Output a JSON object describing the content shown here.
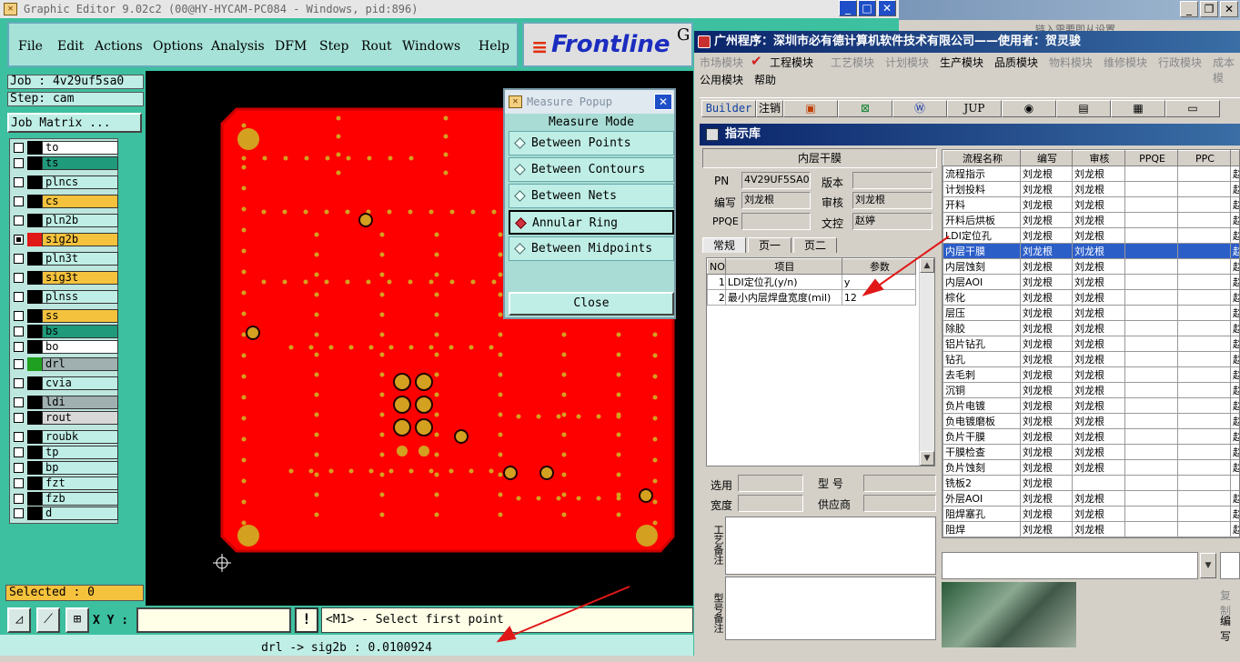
{
  "graphic_editor": {
    "title": "Graphic Editor 9.02c2 (00@HY-HYCAM-PC084 - Windows, pid:896)",
    "menu": [
      "File",
      "Edit",
      "Actions",
      "Options",
      "Analysis",
      "DFM",
      "Step",
      "Rout",
      "Windows",
      "Help"
    ],
    "brand": "Frontline",
    "brand_tail": "G",
    "job": "Job : 4v29uf5sa0",
    "step": "Step: cam",
    "job_matrix": "Job Matrix ...",
    "layers": [
      {
        "name": "to",
        "color": "#ffffff"
      },
      {
        "name": "ts",
        "color": "#1f9a7a"
      },
      {
        "name": "plncs",
        "color": "#bfeee6"
      },
      {
        "name": "cs",
        "color": "#f5c23d"
      },
      {
        "name": "pln2b",
        "color": "#bfeee6"
      },
      {
        "name": "sig2b",
        "color": "#f5c23d"
      },
      {
        "name": "pln3t",
        "color": "#bfeee6"
      },
      {
        "name": "sig3t",
        "color": "#f5c23d"
      },
      {
        "name": "plnss",
        "color": "#bfeee6"
      },
      {
        "name": "ss",
        "color": "#f5c23d"
      },
      {
        "name": "bs",
        "color": "#1f9a7a"
      },
      {
        "name": "bo",
        "color": "#ffffff"
      },
      {
        "name": "drl",
        "color": "#a0b0b0"
      },
      {
        "name": "cvia",
        "color": "#bfeee6"
      },
      {
        "name": "ldi",
        "color": "#a0b0b0"
      },
      {
        "name": "rout",
        "color": "#d8d8d8"
      },
      {
        "name": "roubk",
        "color": "#bfeee6"
      },
      {
        "name": "tp",
        "color": "#bfeee6"
      },
      {
        "name": "bp",
        "color": "#bfeee6"
      },
      {
        "name": "fzt",
        "color": "#bfeee6"
      },
      {
        "name": "fzb",
        "color": "#bfeee6"
      },
      {
        "name": "d",
        "color": "#bfeee6"
      }
    ],
    "selected": "Selected : 0",
    "xy_label": "X Y :",
    "xy_value": "",
    "prompt": "<M1> - Select first point",
    "status": "drl -> sig2b : 0.0100924",
    "colors": {
      "board": "#ff0000",
      "pad": "#d4a020",
      "panel": "#3cc0a0"
    }
  },
  "measure_popup": {
    "title": "Measure Popup",
    "mode_label": "Measure Mode",
    "options": [
      "Between Points",
      "Between Contours",
      "Between Nets",
      "Annular Ring",
      "Between Midpoints"
    ],
    "selected": "Annular Ring",
    "close": "Close"
  },
  "cn_app": {
    "title": "广州程序：深圳市必有德计算机软件技术有限公司——使用者：贺灵骏",
    "menu1": [
      "市场模块",
      "工程模块",
      "工艺模块",
      "计划模块",
      "生产模块",
      "品质模块",
      "物料模块",
      "维修模块",
      "行政模块",
      "成本模"
    ],
    "menu2": [
      "公用模块",
      "帮助"
    ],
    "toolbar": [
      "Builder",
      "注销",
      "",
      "",
      "",
      "JUP",
      "",
      "",
      "",
      ""
    ],
    "panel_title": "指示库",
    "section": "内层干膜",
    "pn_label": "PN",
    "pn_value": "4V29UF5SA0",
    "version_label": "版本",
    "version_value": "",
    "author_label": "编写",
    "author_value": "刘龙根",
    "review_label": "审核",
    "review_value": "刘龙根",
    "ppqe_label": "PPQE",
    "ppqe_value": "",
    "docctl_label": "文控",
    "docctl_value": "赵婷",
    "tabs": [
      "常规",
      "页一",
      "页二"
    ],
    "param_headers": [
      "NO",
      "项目",
      "参数"
    ],
    "params": [
      [
        "1",
        "LDI定位孔(y/n)",
        "y"
      ],
      [
        "2",
        "最小内层焊盘宽度(mil)",
        "12"
      ]
    ],
    "select_label": "选用",
    "model_label": "型 号",
    "width_label": "宽度",
    "supplier_label": "供应商",
    "note1": "工艺备注",
    "note2": "型号备注",
    "flow_headers": [
      "流程名称",
      "编写",
      "审核",
      "PPQE",
      "PPC"
    ],
    "flow_rows": [
      [
        "流程指示",
        "刘龙根",
        "刘龙根"
      ],
      [
        "计划投料",
        "刘龙根",
        "刘龙根"
      ],
      [
        "开料",
        "刘龙根",
        "刘龙根"
      ],
      [
        "开料后烘板",
        "刘龙根",
        "刘龙根"
      ],
      [
        "LDI定位孔",
        "刘龙根",
        "刘龙根"
      ],
      [
        "内层干膜",
        "刘龙根",
        "刘龙根"
      ],
      [
        "内层蚀刻",
        "刘龙根",
        "刘龙根"
      ],
      [
        "内层AOI",
        "刘龙根",
        "刘龙根"
      ],
      [
        "棕化",
        "刘龙根",
        "刘龙根"
      ],
      [
        "层压",
        "刘龙根",
        "刘龙根"
      ],
      [
        "除胶",
        "刘龙根",
        "刘龙根"
      ],
      [
        "铝片钻孔",
        "刘龙根",
        "刘龙根"
      ],
      [
        "钻孔",
        "刘龙根",
        "刘龙根"
      ],
      [
        "去毛刺",
        "刘龙根",
        "刘龙根"
      ],
      [
        "沉铜",
        "刘龙根",
        "刘龙根"
      ],
      [
        "负片电镀",
        "刘龙根",
        "刘龙根"
      ],
      [
        "负电镀磨板",
        "刘龙根",
        "刘龙根"
      ],
      [
        "负片干膜",
        "刘龙根",
        "刘龙根"
      ],
      [
        "干膜检查",
        "刘龙根",
        "刘龙根"
      ],
      [
        "负片蚀刻",
        "刘龙根",
        "刘龙根"
      ],
      [
        "铣板2",
        "刘龙根",
        ""
      ],
      [
        "外层AOI",
        "刘龙根",
        "刘龙根"
      ],
      [
        "阻焊塞孔",
        "刘龙根",
        "刘龙根"
      ],
      [
        "阻焊",
        "刘龙根",
        "刘龙根"
      ]
    ],
    "flow_selected": 5,
    "flow_last_col": "赵",
    "side_buttons": [
      "复制",
      "编写"
    ]
  },
  "bg_window": {
    "title": "链入需要即从设置"
  }
}
